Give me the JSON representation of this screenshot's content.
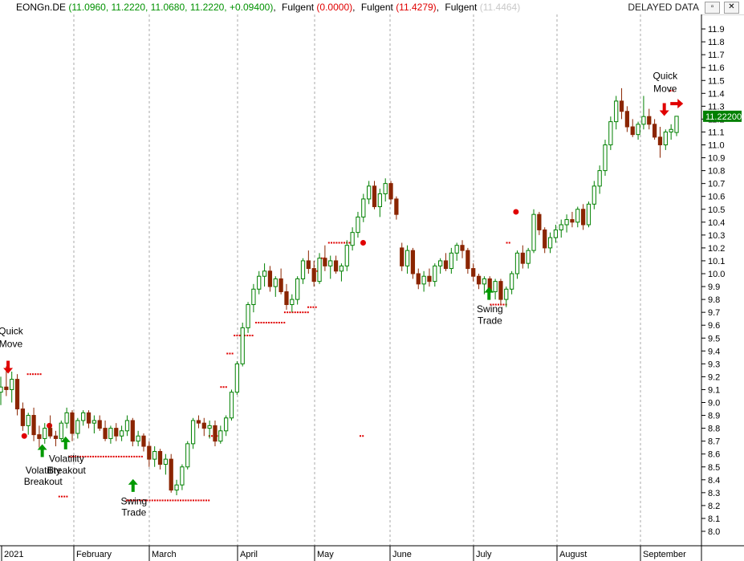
{
  "header": {
    "symbol": "EONGn.DE",
    "ohlc": "(11.0960, 11.2220, 11.0680, 11.2220, +0.09400)",
    "ind1_name": "Fulgent",
    "ind1_value": "(0.0000)",
    "ind2_name": "Fulgent",
    "ind2_value": "(11.4279)",
    "ind3_name": "Fulgent",
    "ind3_value": "(11.4464)",
    "delayed_label": "DELAYED DATA",
    "restore_icon": "restore-icon",
    "close_icon": "close-icon"
  },
  "chart_data": {
    "type": "candlestick",
    "colors": {
      "up": "#008000",
      "down": "#8b2500",
      "stop": "#e00000",
      "signal_up": "#009900",
      "signal_down": "#e00000",
      "last_price_bg": "#008000"
    },
    "y_ticks": [
      "11.9",
      "11.8",
      "11.7",
      "11.6",
      "11.5",
      "11.4",
      "11.3",
      "11.2",
      "11.1",
      "11.0",
      "10.9",
      "10.8",
      "10.7",
      "10.6",
      "10.5",
      "10.4",
      "10.3",
      "10.2",
      "10.1",
      "10.0",
      "9.9",
      "9.8",
      "9.7",
      "9.6",
      "9.5",
      "9.4",
      "9.3",
      "9.2",
      "9.1",
      "9.0",
      "8.9",
      "8.8",
      "8.7",
      "8.6",
      "8.5",
      "8.4",
      "8.3",
      "8.2",
      "8.1",
      "8.0"
    ],
    "x_labels": [
      "2021",
      "February",
      "March",
      "April",
      "May",
      "June",
      "July",
      "August",
      "September"
    ],
    "ylim": [
      7.93,
      12.0
    ],
    "grid": "vertical dashed at month starts",
    "last_price": "11.22200",
    "candles": [
      [
        9.08,
        9.2,
        8.98,
        9.12
      ],
      [
        9.12,
        9.28,
        9.05,
        9.1
      ],
      [
        9.1,
        9.24,
        9.0,
        9.18
      ],
      [
        9.18,
        9.22,
        8.9,
        8.95
      ],
      [
        8.95,
        9.0,
        8.78,
        8.82
      ],
      [
        8.82,
        8.92,
        8.75,
        8.9
      ],
      [
        8.9,
        8.96,
        8.7,
        8.75
      ],
      [
        8.75,
        8.82,
        8.65,
        8.72
      ],
      [
        8.72,
        8.84,
        8.68,
        8.8
      ],
      [
        8.8,
        8.9,
        8.72,
        8.74
      ],
      [
        8.74,
        8.78,
        8.66,
        8.72
      ],
      [
        8.72,
        8.86,
        8.7,
        8.84
      ],
      [
        8.84,
        8.96,
        8.8,
        8.92
      ],
      [
        8.92,
        8.94,
        8.7,
        8.76
      ],
      [
        8.76,
        8.88,
        8.72,
        8.86
      ],
      [
        8.86,
        8.94,
        8.82,
        8.92
      ],
      [
        8.92,
        8.94,
        8.8,
        8.84
      ],
      [
        8.84,
        8.9,
        8.76,
        8.86
      ],
      [
        8.86,
        8.9,
        8.78,
        8.8
      ],
      [
        8.8,
        8.86,
        8.7,
        8.72
      ],
      [
        8.72,
        8.82,
        8.68,
        8.8
      ],
      [
        8.8,
        8.84,
        8.7,
        8.74
      ],
      [
        8.74,
        8.82,
        8.7,
        8.78
      ],
      [
        8.78,
        8.9,
        8.74,
        8.86
      ],
      [
        8.86,
        8.88,
        8.66,
        8.7
      ],
      [
        8.7,
        8.78,
        8.66,
        8.74
      ],
      [
        8.74,
        8.76,
        8.62,
        8.66
      ],
      [
        8.66,
        8.7,
        8.5,
        8.56
      ],
      [
        8.56,
        8.66,
        8.5,
        8.62
      ],
      [
        8.62,
        8.64,
        8.48,
        8.52
      ],
      [
        8.52,
        8.6,
        8.44,
        8.56
      ],
      [
        8.56,
        8.6,
        8.3,
        8.32
      ],
      [
        8.32,
        8.4,
        8.28,
        8.36
      ],
      [
        8.36,
        8.52,
        8.32,
        8.5
      ],
      [
        8.5,
        8.7,
        8.48,
        8.68
      ],
      [
        8.68,
        8.88,
        8.64,
        8.86
      ],
      [
        8.86,
        8.9,
        8.8,
        8.84
      ],
      [
        8.84,
        8.88,
        8.74,
        8.8
      ],
      [
        8.8,
        8.86,
        8.72,
        8.82
      ],
      [
        8.82,
        8.86,
        8.66,
        8.7
      ],
      [
        8.7,
        8.82,
        8.68,
        8.78
      ],
      [
        8.78,
        8.9,
        8.74,
        8.88
      ],
      [
        8.88,
        9.1,
        8.86,
        9.08
      ],
      [
        9.08,
        9.32,
        9.06,
        9.3
      ],
      [
        9.3,
        9.62,
        9.28,
        9.58
      ],
      [
        9.58,
        9.78,
        9.54,
        9.76
      ],
      [
        9.76,
        9.92,
        9.7,
        9.88
      ],
      [
        9.88,
        10.02,
        9.84,
        9.98
      ],
      [
        9.98,
        10.08,
        9.9,
        10.02
      ],
      [
        10.02,
        10.06,
        9.86,
        9.9
      ],
      [
        9.9,
        9.98,
        9.82,
        9.96
      ],
      [
        9.96,
        10.04,
        9.84,
        9.86
      ],
      [
        9.86,
        9.92,
        9.72,
        9.76
      ],
      [
        9.76,
        9.84,
        9.7,
        9.8
      ],
      [
        9.8,
        9.98,
        9.76,
        9.96
      ],
      [
        9.96,
        10.12,
        9.92,
        10.1
      ],
      [
        10.1,
        10.18,
        10.0,
        10.04
      ],
      [
        10.04,
        10.1,
        9.9,
        9.94
      ],
      [
        9.94,
        10.16,
        9.92,
        10.12
      ],
      [
        10.12,
        10.22,
        10.02,
        10.06
      ],
      [
        10.06,
        10.14,
        9.96,
        10.1
      ],
      [
        10.1,
        10.14,
        10.0,
        10.02
      ],
      [
        10.02,
        10.08,
        9.94,
        10.06
      ],
      [
        10.06,
        10.26,
        10.02,
        10.22
      ],
      [
        10.22,
        10.36,
        10.18,
        10.32
      ],
      [
        10.32,
        10.48,
        10.28,
        10.44
      ],
      [
        10.44,
        10.62,
        10.4,
        10.58
      ],
      [
        10.58,
        10.72,
        10.54,
        10.68
      ],
      [
        10.68,
        10.72,
        10.5,
        10.52
      ],
      [
        10.52,
        10.66,
        10.44,
        10.62
      ],
      [
        10.62,
        10.74,
        10.56,
        10.7
      ],
      [
        10.7,
        10.72,
        10.54,
        10.58
      ],
      [
        10.58,
        10.6,
        10.42,
        10.46
      ],
      [
        10.2,
        10.24,
        10.02,
        10.06
      ],
      [
        10.06,
        10.22,
        10.0,
        10.18
      ],
      [
        10.18,
        10.2,
        9.96,
        10.0
      ],
      [
        10.0,
        10.04,
        9.88,
        9.92
      ],
      [
        9.92,
        10.02,
        9.86,
        9.98
      ],
      [
        9.98,
        10.04,
        9.9,
        9.94
      ],
      [
        9.94,
        10.08,
        9.9,
        10.06
      ],
      [
        10.06,
        10.12,
        10.0,
        10.1
      ],
      [
        10.1,
        10.16,
        10.02,
        10.04
      ],
      [
        10.04,
        10.2,
        10.0,
        10.16
      ],
      [
        10.16,
        10.24,
        10.1,
        10.22
      ],
      [
        10.22,
        10.26,
        10.12,
        10.18
      ],
      [
        10.18,
        10.2,
        10.0,
        10.04
      ],
      [
        10.04,
        10.08,
        9.94,
        9.98
      ],
      [
        9.98,
        10.0,
        9.88,
        9.92
      ],
      [
        9.92,
        9.98,
        9.84,
        9.96
      ],
      [
        9.96,
        9.98,
        9.82,
        9.86
      ],
      [
        9.86,
        9.96,
        9.8,
        9.94
      ],
      [
        9.94,
        9.96,
        9.76,
        9.8
      ],
      [
        9.8,
        9.9,
        9.74,
        9.88
      ],
      [
        9.88,
        10.02,
        9.84,
        10.0
      ],
      [
        10.0,
        10.18,
        9.96,
        10.16
      ],
      [
        10.16,
        10.22,
        10.04,
        10.08
      ],
      [
        10.08,
        10.2,
        10.04,
        10.18
      ],
      [
        10.18,
        10.5,
        10.16,
        10.46
      ],
      [
        10.46,
        10.48,
        10.3,
        10.34
      ],
      [
        10.34,
        10.36,
        10.16,
        10.2
      ],
      [
        10.2,
        10.32,
        10.16,
        10.28
      ],
      [
        10.28,
        10.38,
        10.24,
        10.34
      ],
      [
        10.34,
        10.42,
        10.28,
        10.38
      ],
      [
        10.38,
        10.46,
        10.32,
        10.42
      ],
      [
        10.42,
        10.48,
        10.36,
        10.4
      ],
      [
        10.4,
        10.52,
        10.36,
        10.5
      ],
      [
        10.5,
        10.54,
        10.34,
        10.38
      ],
      [
        10.38,
        10.56,
        10.36,
        10.54
      ],
      [
        10.54,
        10.72,
        10.5,
        10.68
      ],
      [
        10.68,
        10.84,
        10.62,
        10.8
      ],
      [
        10.8,
        11.04,
        10.76,
        11.0
      ],
      [
        11.0,
        11.22,
        10.96,
        11.18
      ],
      [
        11.18,
        11.38,
        11.12,
        11.34
      ],
      [
        11.34,
        11.44,
        11.2,
        11.26
      ],
      [
        11.26,
        11.3,
        11.1,
        11.14
      ],
      [
        11.14,
        11.2,
        11.06,
        11.08
      ],
      [
        11.08,
        11.18,
        11.04,
        11.16
      ],
      [
        11.16,
        11.38,
        11.12,
        11.22
      ],
      [
        11.22,
        11.28,
        11.12,
        11.16
      ],
      [
        11.16,
        11.2,
        11.04,
        11.06
      ],
      [
        11.06,
        11.14,
        10.9,
        11.0
      ],
      [
        11.0,
        11.12,
        10.96,
        11.1
      ],
      [
        11.1,
        11.16,
        11.04,
        11.12
      ],
      [
        11.096,
        11.222,
        11.068,
        11.222
      ]
    ],
    "stop_segments": [
      {
        "x0": 0.03,
        "x1": 0.045,
        "y": 9.22
      },
      {
        "x0": 0.065,
        "x1": 0.075,
        "y": 8.27
      },
      {
        "x0": 0.077,
        "x1": 0.157,
        "y": 8.58
      },
      {
        "x0": 0.14,
        "x1": 0.232,
        "y": 8.24
      },
      {
        "x0": 0.232,
        "x1": 0.245,
        "y": 8.74
      },
      {
        "x0": 0.245,
        "x1": 0.252,
        "y": 9.12
      },
      {
        "x0": 0.252,
        "x1": 0.258,
        "y": 9.38
      },
      {
        "x0": 0.26,
        "x1": 0.28,
        "y": 9.52
      },
      {
        "x0": 0.284,
        "x1": 0.316,
        "y": 9.62
      },
      {
        "x0": 0.316,
        "x1": 0.342,
        "y": 9.7
      },
      {
        "x0": 0.342,
        "x1": 0.352,
        "y": 9.74
      },
      {
        "x0": 0.352,
        "x1": 0.357,
        "y": 10.02
      },
      {
        "x0": 0.357,
        "x1": 0.362,
        "y": 10.12
      },
      {
        "x0": 0.365,
        "x1": 0.392,
        "y": 10.24
      },
      {
        "x0": 0.4,
        "x1": 0.405,
        "y": 8.74
      },
      {
        "x0": 0.545,
        "x1": 0.565,
        "y": 9.76
      },
      {
        "x0": 0.563,
        "x1": 0.568,
        "y": 10.24
      },
      {
        "x0": 0.745,
        "x1": 0.75,
        "y": 11.42
      }
    ],
    "stop_dots": [
      {
        "x": 0.027,
        "y": 8.74
      },
      {
        "x": 0.055,
        "y": 8.82
      },
      {
        "x": 0.404,
        "y": 10.24
      },
      {
        "x": 0.574,
        "y": 10.48
      }
    ],
    "signals": [
      {
        "kind": "down",
        "x": 0.009,
        "y": 9.28,
        "label1": "Quick",
        "label2": "Move",
        "lx": 0.012,
        "ly1": 9.53,
        "ly2": 9.43
      },
      {
        "kind": "up",
        "x": 0.047,
        "y": 8.62,
        "label1": "Volatility",
        "label2": "Breakout",
        "lx": 0.048,
        "ly1": 8.45,
        "ly2": 8.36
      },
      {
        "kind": "up",
        "x": 0.073,
        "y": 8.68,
        "label1": "Volatility",
        "label2": "Breakout",
        "lx": 0.074,
        "ly1": 8.54,
        "ly2": 8.45
      },
      {
        "kind": "up",
        "x": 0.148,
        "y": 8.35,
        "label1": "Swing",
        "label2": "Trade",
        "lx": 0.149,
        "ly1": 8.21,
        "ly2": 8.12
      },
      {
        "kind": "up",
        "x": 0.544,
        "y": 9.84,
        "label1": "Swing",
        "label2": "Trade",
        "lx": 0.545,
        "ly1": 9.7,
        "ly2": 9.61
      },
      {
        "kind": "down",
        "x": 0.739,
        "y": 11.28,
        "label1": "Quick",
        "label2": "Move",
        "lx": 0.74,
        "ly1": 11.51,
        "ly2": 11.41
      },
      {
        "kind": "right",
        "x": 0.752,
        "y": 11.32,
        "label1": "",
        "label2": "",
        "lx": 0,
        "ly1": 0,
        "ly2": 0
      }
    ]
  }
}
